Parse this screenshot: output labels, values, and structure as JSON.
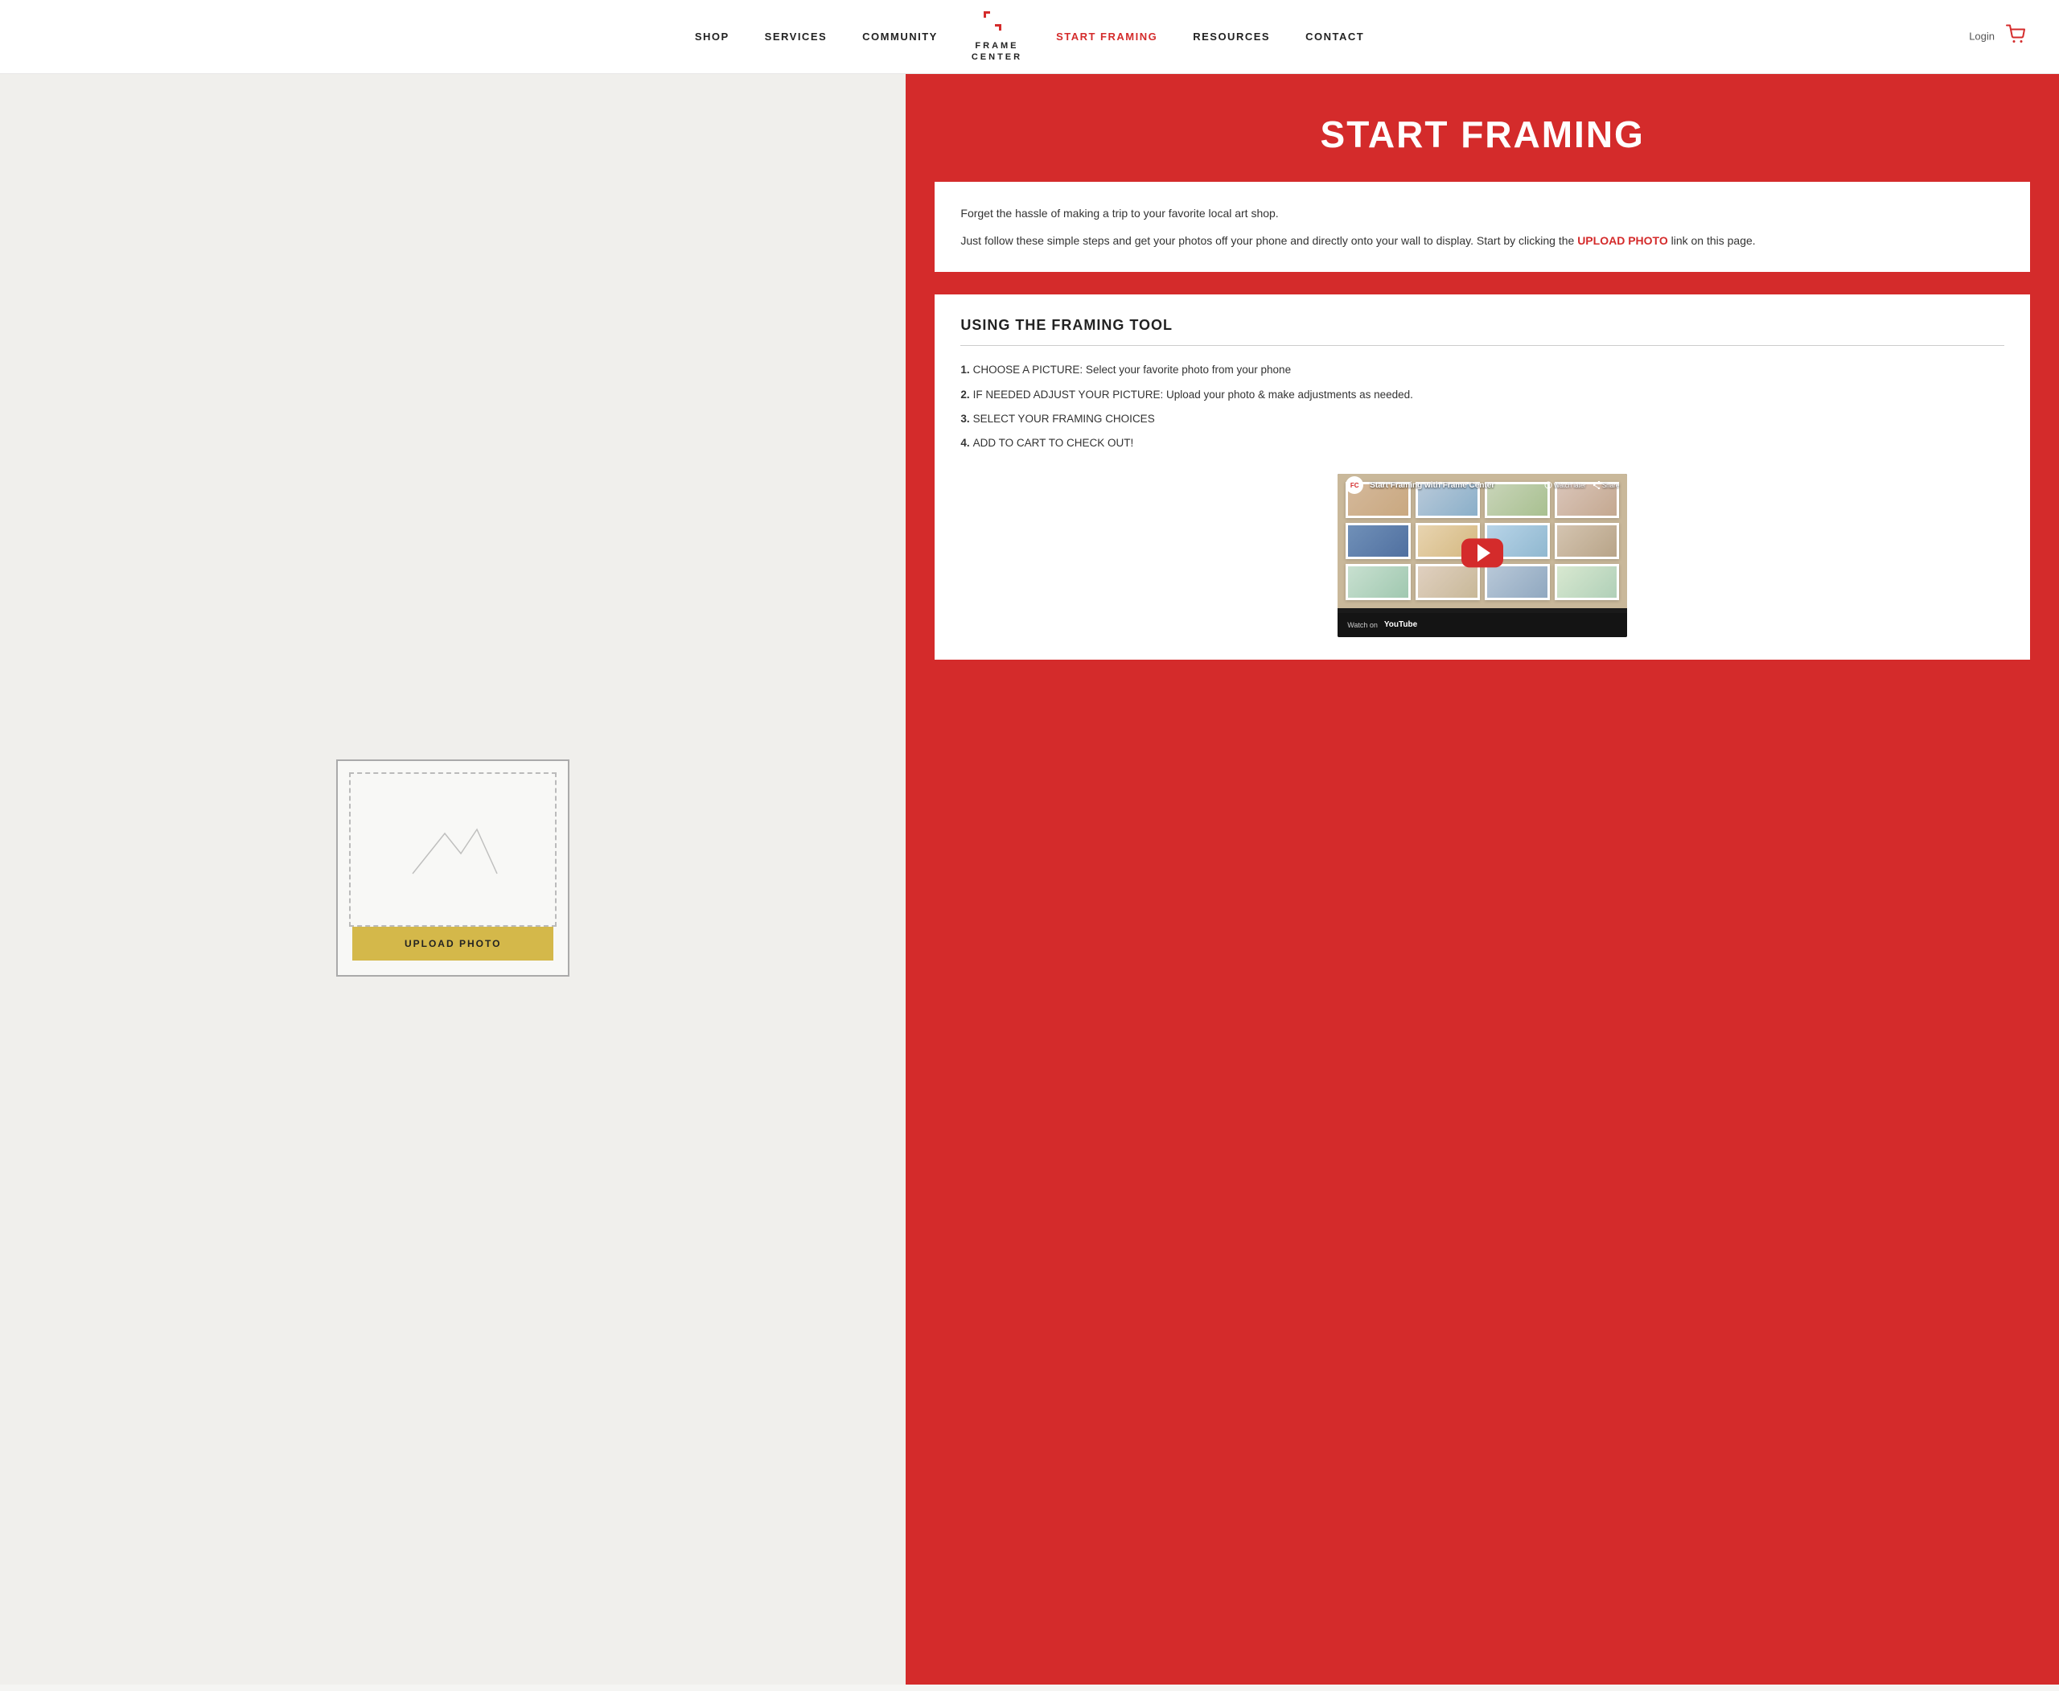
{
  "header": {
    "login_label": "Login",
    "nav": [
      {
        "id": "shop",
        "label": "SHOP",
        "active": false
      },
      {
        "id": "services",
        "label": "SERVICES",
        "active": false
      },
      {
        "id": "community",
        "label": "COMMUNITY",
        "active": false
      },
      {
        "id": "start-framing",
        "label": "START FRAMING",
        "active": true
      },
      {
        "id": "resources",
        "label": "RESOURCES",
        "active": false
      },
      {
        "id": "contact",
        "label": "CONTACT",
        "active": false
      }
    ],
    "logo": {
      "line1": "FRAME",
      "line2": "CENTER"
    }
  },
  "left": {
    "upload_button_label": "UPLOAD PHOTO"
  },
  "right": {
    "title": "START FRAMING",
    "intro_para1": "Forget the hassle of making a trip to your favorite local art shop.",
    "intro_para2_before": "Just follow these simple steps and get your photos off your phone and directly onto your wall to display. Start by clicking the ",
    "upload_link_text": "UPLOAD PHOTO",
    "intro_para2_after": " link on this page.",
    "framing_tool_title": "USING THE FRAMING TOOL",
    "steps": [
      {
        "num": "1.",
        "text": "CHOOSE A PICTURE: Select your favorite photo from your phone"
      },
      {
        "num": "2.",
        "text": "IF NEEDED ADJUST YOUR PICTURE: Upload your photo & make adjustments as needed."
      },
      {
        "num": "3.",
        "text": "SELECT YOUR FRAMING CHOICES"
      },
      {
        "num": "4.",
        "text": "ADD TO CART TO CHECK OUT!"
      }
    ],
    "video": {
      "title": "Start Framing with Frame Center",
      "watch_later": "Watch later",
      "share": "Share",
      "watch_on": "Watch on",
      "youtube": "YouTube"
    }
  },
  "colors": {
    "red": "#d42b2b",
    "gold": "#d4b84a",
    "bg_left": "#f0efec"
  }
}
